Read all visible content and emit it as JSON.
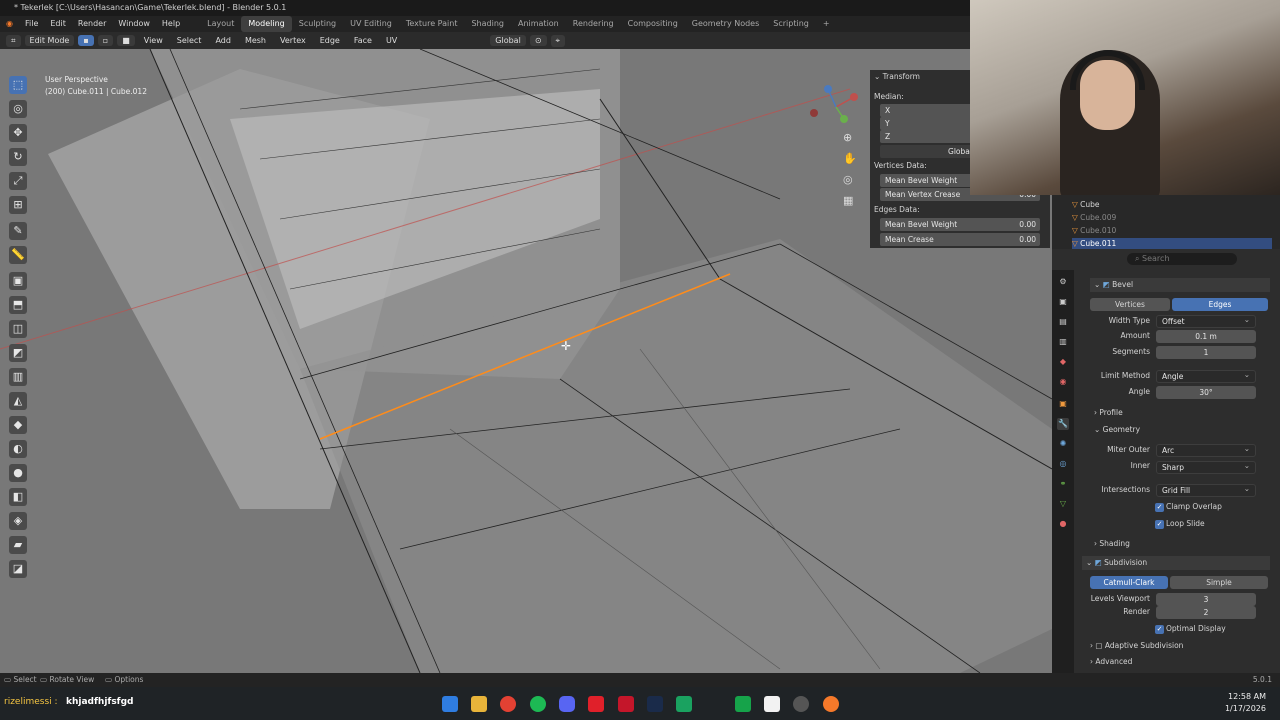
{
  "window": {
    "title": "* Tekerlek [C:\\Users\\Hasancan\\Game\\Tekerlek.blend] - Blender 5.0.1"
  },
  "menus": [
    "File",
    "Edit",
    "Render",
    "Window",
    "Help"
  ],
  "workspaces": [
    "Layout",
    "Modeling",
    "Sculpting",
    "UV Editing",
    "Texture Paint",
    "Shading",
    "Animation",
    "Rendering",
    "Compositing",
    "Geometry Nodes",
    "Scripting"
  ],
  "active_workspace": "Modeling",
  "header": {
    "mode": "Edit Mode",
    "view": "View",
    "select": "Select",
    "add": "Add",
    "mesh": "Mesh",
    "vertex": "Vertex",
    "edge": "Edge",
    "face": "Face",
    "uv": "UV",
    "orientation": "Global"
  },
  "viewport": {
    "perspective": "User Perspective",
    "object_info": "(200) Cube.011 | Cube.012"
  },
  "npanel": {
    "title": "Transform",
    "median": "Median:",
    "x": "X",
    "y": "Y",
    "z": "Z",
    "global": "Global",
    "vertices_data": "Vertices Data:",
    "mean_bevel_weight_v": "Mean Bevel Weight",
    "mean_vertex_crease": "Mean Vertex Crease",
    "mean_vertex_crease_val": "0.00",
    "edges_data": "Edges Data:",
    "mean_bevel_weight_e": "Mean Bevel Weight",
    "mean_bevel_weight_e_val": "0.00",
    "mean_crease": "Mean Crease",
    "mean_crease_val": "0.00"
  },
  "outliner": {
    "items": [
      {
        "name": "Cube"
      },
      {
        "name": "Cube.009"
      },
      {
        "name": "Cube.010"
      },
      {
        "name": "Cube.011"
      }
    ],
    "search_placeholder": "Search"
  },
  "bevel": {
    "name": "Bevel",
    "vertices": "Vertices",
    "edges": "Edges",
    "width_type_label": "Width Type",
    "width_type": "Offset",
    "amount_label": "Amount",
    "amount": "0.1 m",
    "segments_label": "Segments",
    "segments": "1",
    "limit_method_label": "Limit Method",
    "limit_method": "Angle",
    "angle_label": "Angle",
    "angle": "30°",
    "profile": "Profile",
    "geometry": "Geometry",
    "miter_outer_label": "Miter Outer",
    "miter_outer": "Arc",
    "inner_label": "Inner",
    "inner": "Sharp",
    "intersections_label": "Intersections",
    "intersections": "Grid Fill",
    "clamp_overlap": "Clamp Overlap",
    "loop_slide": "Loop Slide",
    "shading": "Shading"
  },
  "subdivision": {
    "name": "Subdivision",
    "catmull": "Catmull-Clark",
    "simple": "Simple",
    "levels_viewport_label": "Levels Viewport",
    "levels_viewport": "3",
    "render_label": "Render",
    "render": "2",
    "optimal_display": "Optimal Display",
    "adaptive": "Adaptive Subdivision",
    "advanced": "Advanced"
  },
  "statusbar": {
    "select": "Select",
    "rotate": "Rotate View",
    "options": "Options",
    "version": "5.0.1"
  },
  "taskbar": {
    "stream_text": "khjadfhjfsfgd",
    "stream_user": "rizelimessi :",
    "time": "12:58 AM",
    "date": "1/17/2026"
  },
  "colors": {
    "accent": "#4772b3",
    "orange": "#ff8c1a",
    "viewport": "#787878"
  }
}
